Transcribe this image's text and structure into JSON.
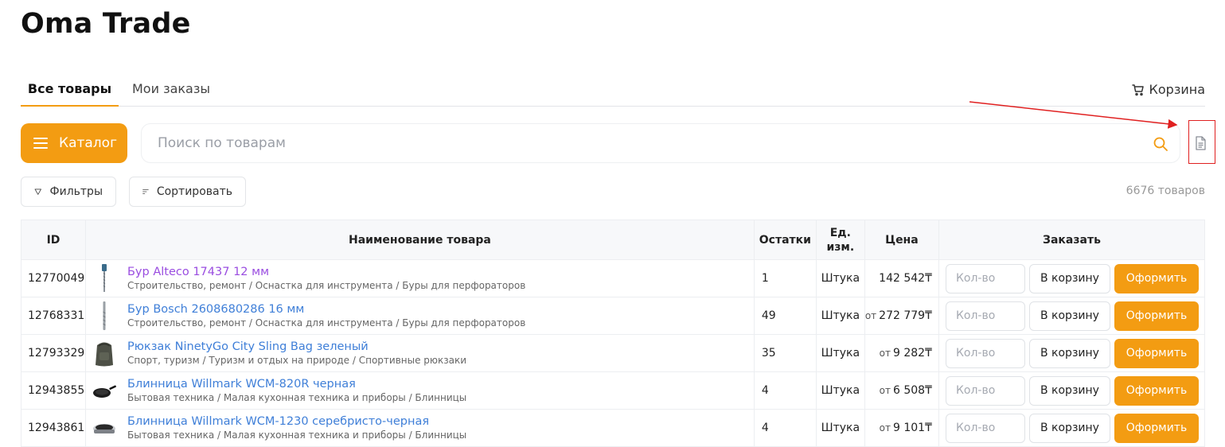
{
  "app": {
    "title": "Oma Trade"
  },
  "tabs": [
    {
      "label": "Все товары",
      "active": true
    },
    {
      "label": "Мои заказы",
      "active": false
    }
  ],
  "cart": {
    "label": "Корзина",
    "icon": "cart-icon"
  },
  "catalog_button": {
    "label": "Каталог",
    "icon": "menu-icon"
  },
  "search": {
    "placeholder": "Поиск по товарам",
    "value": "",
    "icon": "search-icon"
  },
  "doc_icon": "document-icon",
  "toolbar": {
    "filters_label": "Фильтры",
    "sort_label": "Сортировать",
    "count_text": "6676 товаров"
  },
  "table": {
    "headers": {
      "id": "ID",
      "name": "Наименование товара",
      "stock": "Остатки",
      "unit": "Ед. изм.",
      "price": "Цена",
      "order": "Заказать"
    },
    "rows": [
      {
        "id": "12770049",
        "title": "Бур Alteco 17437 12 мм",
        "path": "Строительство, ремонт / Оснастка для инструмента / Буры для перфораторов",
        "stock": "1",
        "unit": "Штука",
        "price_prefix": "",
        "price": "142 542₸",
        "thumb": "drill-bit"
      },
      {
        "id": "12768331",
        "title": "Бур Bosch 2608680286 16 мм",
        "path": "Строительство, ремонт / Оснастка для инструмента / Буры для перфораторов",
        "stock": "49",
        "unit": "Штука",
        "price_prefix": "от",
        "price": "272 779₸",
        "thumb": "drill-bit-thin"
      },
      {
        "id": "12793329",
        "title": "Рюкзак NinetyGo City Sling Bag зеленый",
        "path": "Спорт, туризм / Туризм и отдых на природе / Спортивные рюкзаки",
        "stock": "35",
        "unit": "Штука",
        "price_prefix": "от",
        "price": "9 282₸",
        "thumb": "backpack"
      },
      {
        "id": "12943855",
        "title": "Блинница Willmark WCM-820R черная",
        "path": "Бытовая техника / Малая кухонная техника и приборы / Блинницы",
        "stock": "4",
        "unit": "Штука",
        "price_prefix": "от",
        "price": "6 508₸",
        "thumb": "pan"
      },
      {
        "id": "12943861",
        "title": "Блинница Willmark WCM-1230 серебристо-черная",
        "path": "Бытовая техника / Малая кухонная техника и приборы / Блинницы",
        "stock": "4",
        "unit": "Штука",
        "price_prefix": "от",
        "price": "9 101₸",
        "thumb": "crepe-maker"
      }
    ],
    "qty_placeholder": "Кол-во",
    "cart_button": "В корзину",
    "checkout_button": "Оформить"
  },
  "colors": {
    "accent": "#f39c12",
    "link": "#3f7fd8",
    "visited_link": "#9a4de0",
    "annotation": "#e02020"
  }
}
